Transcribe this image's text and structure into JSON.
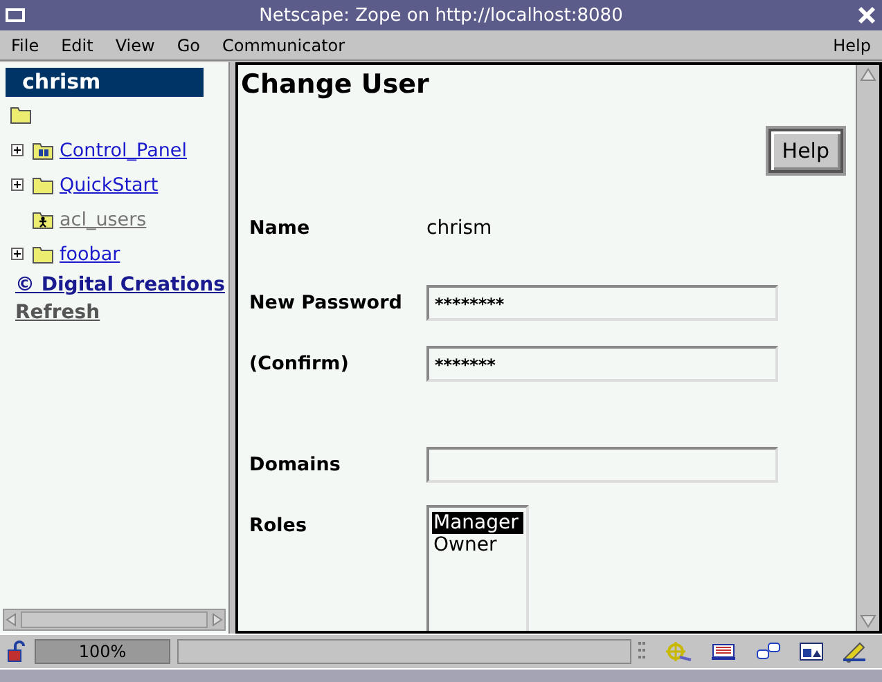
{
  "window": {
    "title": "Netscape: Zope on http://localhost:8080"
  },
  "menu": {
    "items": [
      "File",
      "Edit",
      "View",
      "Go",
      "Communicator"
    ],
    "help": "Help"
  },
  "tree": {
    "header": "chrism",
    "items": [
      {
        "label": "Control_Panel",
        "kind": "control",
        "expandable": true,
        "visited": false
      },
      {
        "label": "QuickStart",
        "kind": "folder",
        "expandable": true,
        "visited": false
      },
      {
        "label": "acl_users",
        "kind": "users",
        "expandable": false,
        "visited": true
      },
      {
        "label": "foobar",
        "kind": "folder",
        "expandable": true,
        "visited": false
      }
    ],
    "links": [
      {
        "label": "© Digital Creations",
        "kind": "credit"
      },
      {
        "label": "Refresh",
        "kind": "refresh"
      }
    ]
  },
  "form": {
    "title": "Change User",
    "help_button": "Help",
    "fields": [
      {
        "label": "Name",
        "kind": "text",
        "value": "chrism"
      },
      {
        "label": "New Password",
        "kind": "password",
        "value": "********"
      },
      {
        "label": "(Confirm)",
        "kind": "password",
        "value": "*******"
      },
      {
        "label": "Domains",
        "kind": "input"
      },
      {
        "label": "Roles",
        "kind": "list",
        "options": [
          {
            "label": "Manager",
            "selected": true
          },
          {
            "label": "Owner",
            "selected": false
          }
        ]
      }
    ]
  },
  "status_bar": {
    "zoom": "100%"
  }
}
